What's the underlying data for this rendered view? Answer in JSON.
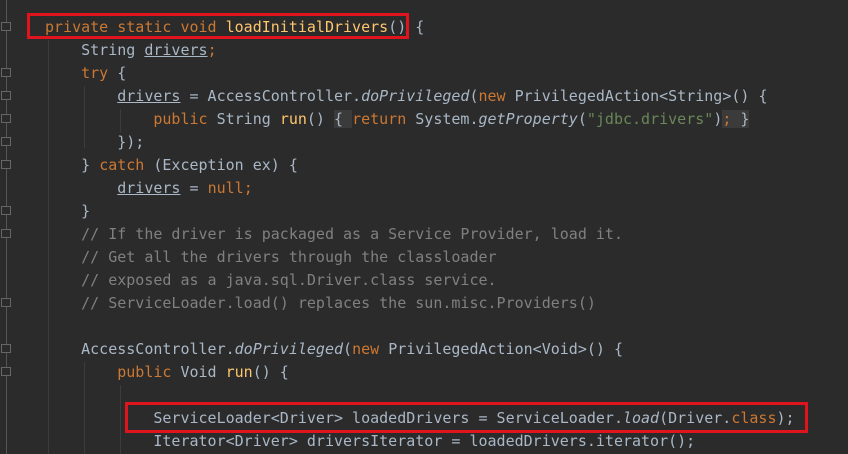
{
  "editor": {
    "lines": [
      [
        [
          "private static void ",
          "kw"
        ],
        [
          "loadInitialDrivers",
          "fn"
        ],
        [
          "() {",
          ""
        ]
      ],
      [
        [
          "    String ",
          ""
        ],
        [
          "drivers",
          "ul"
        ],
        [
          ";",
          "kw"
        ]
      ],
      [
        [
          "    ",
          ""
        ],
        [
          "try",
          "kw"
        ],
        [
          " {",
          ""
        ]
      ],
      [
        [
          "        ",
          ""
        ],
        [
          "drivers",
          "ul"
        ],
        [
          " = AccessController.",
          ""
        ],
        [
          "doPrivileged",
          "it"
        ],
        [
          "(",
          ""
        ],
        [
          "new ",
          "kw"
        ],
        [
          "PrivilegedAction<String>() {",
          ""
        ]
      ],
      [
        [
          "            ",
          ""
        ],
        [
          "public ",
          "kw"
        ],
        [
          "String ",
          ""
        ],
        [
          "run",
          "fn"
        ],
        [
          "() ",
          ""
        ],
        [
          "{ ",
          "fb"
        ],
        [
          "return ",
          "kw"
        ],
        [
          "System.",
          ""
        ],
        [
          "getProperty",
          "it"
        ],
        [
          "(",
          ""
        ],
        [
          "\"jdbc.drivers\"",
          "str"
        ],
        [
          ")",
          ""
        ],
        [
          ";",
          "kw fb"
        ],
        [
          " }",
          "fb"
        ]
      ],
      [
        [
          "        });",
          ""
        ]
      ],
      [
        [
          "    } ",
          ""
        ],
        [
          "catch ",
          "kw"
        ],
        [
          "(Exception ex) {",
          ""
        ]
      ],
      [
        [
          "        ",
          ""
        ],
        [
          "drivers",
          "ul"
        ],
        [
          " = ",
          ""
        ],
        [
          "null",
          "kw"
        ],
        [
          ";",
          "kw"
        ]
      ],
      [
        [
          "    }",
          ""
        ]
      ],
      [
        [
          "    // If the driver is packaged as a Service Provider, load it.",
          "cm"
        ]
      ],
      [
        [
          "    // Get all the drivers through the classloader",
          "cm"
        ]
      ],
      [
        [
          "    // exposed as a java.sql.Driver.class service.",
          "cm"
        ]
      ],
      [
        [
          "    // ServiceLoader.load() replaces the sun.misc.Providers()",
          "cm"
        ]
      ],
      [
        [
          "",
          ""
        ]
      ],
      [
        [
          "    AccessController.",
          ""
        ],
        [
          "doPrivileged",
          "it"
        ],
        [
          "(",
          ""
        ],
        [
          "new ",
          "kw"
        ],
        [
          "PrivilegedAction<Void>() {",
          ""
        ]
      ],
      [
        [
          "        ",
          ""
        ],
        [
          "public ",
          "kw"
        ],
        [
          "Void ",
          ""
        ],
        [
          "run",
          "fn"
        ],
        [
          "() {",
          ""
        ]
      ],
      [
        [
          "",
          ""
        ]
      ],
      [
        [
          "            ServiceLoader<Driver> loadedDrivers = ServiceLoader.",
          ""
        ],
        [
          "load",
          "it"
        ],
        [
          "(Driver.",
          ""
        ],
        [
          "class",
          "kw"
        ],
        [
          ");",
          ""
        ]
      ],
      [
        [
          "            Iterator<Driver> driversIterator = loadedDrivers.iterator();",
          ""
        ]
      ]
    ]
  },
  "highlights": {
    "color": "#e0141c"
  }
}
